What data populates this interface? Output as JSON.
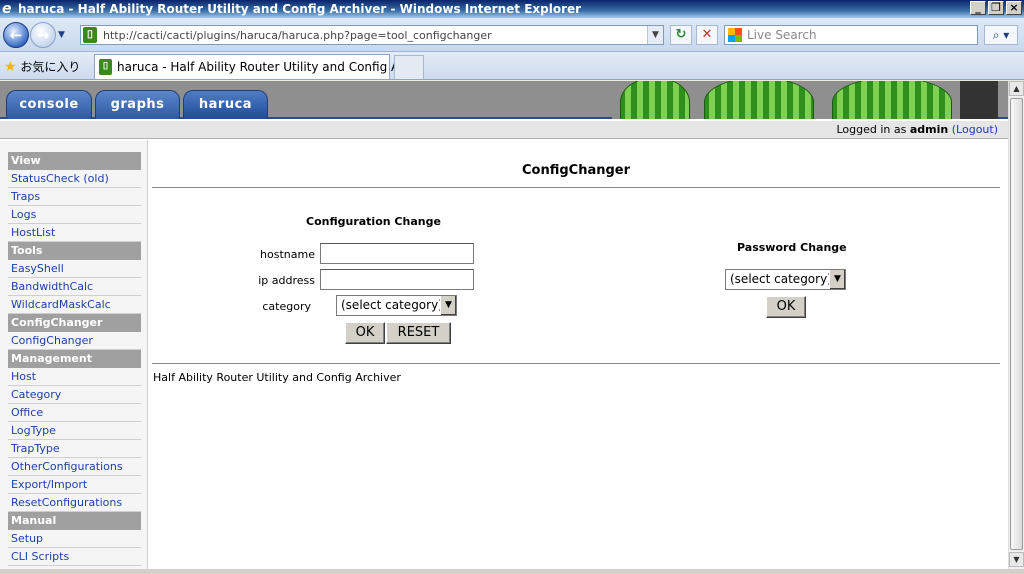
{
  "window": {
    "title": "haruca - Half Ability Router Utility and Config Archiver - Windows Internet Explorer"
  },
  "browser": {
    "url": "http://cacti/cacti/plugins/haruca/haruca.php?page=tool_configchanger",
    "search_placeholder": "Live Search",
    "favorites_label": "お気に入り",
    "tab_title": "haruca - Half Ability Router Utility and Config Arc..."
  },
  "cacti": {
    "tabs": [
      "console",
      "graphs",
      "haruca"
    ],
    "login": {
      "prefix": "Logged in as",
      "user": "admin",
      "logout": "(Logout)"
    }
  },
  "sidebar": {
    "groups": [
      {
        "title": "View",
        "items": [
          "StatusCheck (old)",
          "Traps",
          "Logs",
          "HostList"
        ]
      },
      {
        "title": "Tools",
        "items": [
          "EasyShell",
          "BandwidthCalc",
          "WildcardMaskCalc"
        ]
      },
      {
        "title": "ConfigChanger",
        "items": [
          "ConfigChanger"
        ]
      },
      {
        "title": "Management",
        "items": [
          "Host",
          "Category",
          "Office",
          "LogType",
          "TrapType",
          "OtherConfigurations",
          "Export/Import",
          "ResetConfigurations"
        ]
      },
      {
        "title": "Manual",
        "items": [
          "Setup",
          "CLI Scripts"
        ]
      }
    ]
  },
  "main": {
    "title": "ConfigChanger",
    "config_change": {
      "heading": "Configuration Change",
      "hostname_label": "hostname",
      "hostname_value": "",
      "ip_label": "ip address",
      "ip_value": "",
      "category_label": "category",
      "category_selected": "(select category)",
      "ok_label": "OK",
      "reset_label": "RESET"
    },
    "password_change": {
      "heading": "Password Change",
      "category_selected": "(select category)",
      "ok_label": "OK"
    },
    "footer": "Half Ability Router Utility and Config Archiver"
  }
}
